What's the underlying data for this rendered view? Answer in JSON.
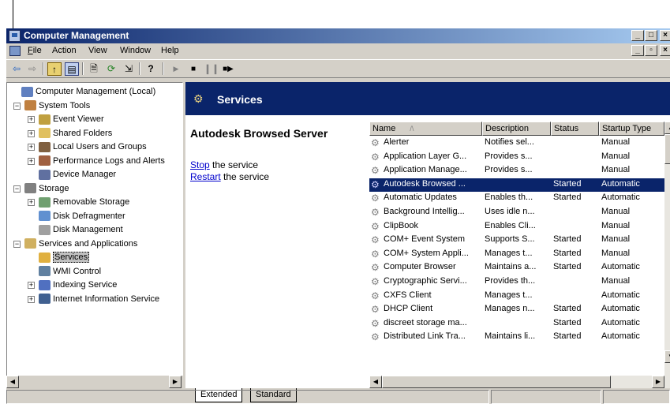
{
  "window": {
    "title": "Computer Management",
    "title_bar_color": "#0a246a",
    "buttons": [
      "minimize",
      "restore",
      "close"
    ]
  },
  "menubar": {
    "items": [
      {
        "label": "File",
        "key": "F"
      },
      {
        "label": "Action",
        "key": "A"
      },
      {
        "label": "View",
        "key": "V"
      },
      {
        "label": "Window",
        "key": "W"
      },
      {
        "label": "Help",
        "key": "H"
      }
    ]
  },
  "toolbar": {
    "icons": [
      "back-icon",
      "forward-icon",
      "up-folder-icon",
      "show-tree-icon",
      "properties-icon",
      "refresh-icon",
      "export-icon",
      "help-icon",
      "start-service-icon",
      "stop-service-icon",
      "pause-service-icon",
      "restart-service-icon"
    ]
  },
  "tree": {
    "items": [
      {
        "label": "Computer Management (Local)",
        "level": 0,
        "icon": "computer-icon",
        "expander": ""
      },
      {
        "label": "System Tools",
        "level": 1,
        "icon": "tools-icon",
        "expander": "−"
      },
      {
        "label": "Event Viewer",
        "level": 2,
        "icon": "event-viewer-icon",
        "expander": "+"
      },
      {
        "label": "Shared Folders",
        "level": 2,
        "icon": "shared-folders-icon",
        "expander": "+"
      },
      {
        "label": "Local Users and Groups",
        "level": 2,
        "icon": "users-icon",
        "expander": "+"
      },
      {
        "label": "Performance Logs and Alerts",
        "level": 2,
        "icon": "performance-icon",
        "expander": "+"
      },
      {
        "label": "Device Manager",
        "level": 2,
        "icon": "device-manager-icon",
        "expander": ""
      },
      {
        "label": "Storage",
        "level": 1,
        "icon": "storage-icon",
        "expander": "−"
      },
      {
        "label": "Removable Storage",
        "level": 2,
        "icon": "removable-storage-icon",
        "expander": "+"
      },
      {
        "label": "Disk Defragmenter",
        "level": 2,
        "icon": "defrag-icon",
        "expander": ""
      },
      {
        "label": "Disk Management",
        "level": 2,
        "icon": "disk-management-icon",
        "expander": ""
      },
      {
        "label": "Services and Applications",
        "level": 1,
        "icon": "services-apps-icon",
        "expander": "−"
      },
      {
        "label": "Services",
        "level": 2,
        "icon": "services-icon",
        "expander": "",
        "selected": true
      },
      {
        "label": "WMI Control",
        "level": 2,
        "icon": "wmi-icon",
        "expander": ""
      },
      {
        "label": "Indexing Service",
        "level": 2,
        "icon": "indexing-icon",
        "expander": "+"
      },
      {
        "label": "Internet Information Service",
        "level": 2,
        "icon": "iis-icon",
        "expander": "+"
      }
    ]
  },
  "services_header": {
    "title": "Services"
  },
  "description": {
    "service_name": "Autodesk Browsed Server",
    "stop_link": "Stop",
    "stop_rest": " the service",
    "restart_link": "Restart",
    "restart_rest": " the service"
  },
  "list": {
    "columns": [
      "Name",
      "Description",
      "Status",
      "Startup Type"
    ],
    "sort_indicator": "/\\",
    "rows": [
      {
        "name": "Alerter",
        "description": "Notifies sel...",
        "status": "",
        "startup": "Manual"
      },
      {
        "name": "Application Layer G...",
        "description": "Provides s...",
        "status": "",
        "startup": "Manual"
      },
      {
        "name": "Application Manage...",
        "description": "Provides s...",
        "status": "",
        "startup": "Manual"
      },
      {
        "name": "Autodesk Browsed ...",
        "description": "",
        "status": "Started",
        "startup": "Automatic",
        "selected": true
      },
      {
        "name": "Automatic Updates",
        "description": "Enables th...",
        "status": "Started",
        "startup": "Automatic"
      },
      {
        "name": "Background Intellig...",
        "description": "Uses idle n...",
        "status": "",
        "startup": "Manual"
      },
      {
        "name": "ClipBook",
        "description": "Enables Cli...",
        "status": "",
        "startup": "Manual"
      },
      {
        "name": "COM+ Event System",
        "description": "Supports S...",
        "status": "Started",
        "startup": "Manual"
      },
      {
        "name": "COM+ System Appli...",
        "description": "Manages t...",
        "status": "Started",
        "startup": "Manual"
      },
      {
        "name": "Computer Browser",
        "description": "Maintains a...",
        "status": "Started",
        "startup": "Automatic"
      },
      {
        "name": "Cryptographic Servi...",
        "description": "Provides th...",
        "status": "",
        "startup": "Manual"
      },
      {
        "name": "CXFS Client",
        "description": "Manages t...",
        "status": "",
        "startup": "Automatic"
      },
      {
        "name": "DHCP Client",
        "description": "Manages n...",
        "status": "Started",
        "startup": "Automatic"
      },
      {
        "name": "discreet storage ma...",
        "description": "",
        "status": "Started",
        "startup": "Automatic"
      },
      {
        "name": "Distributed Link Tra...",
        "description": "Maintains li...",
        "status": "Started",
        "startup": "Automatic"
      }
    ]
  },
  "tabs": {
    "extended": "Extended",
    "standard": "Standard"
  },
  "colors": {
    "selection": "#0a246a",
    "face": "#d4d0c8",
    "link": "#0000cc"
  }
}
